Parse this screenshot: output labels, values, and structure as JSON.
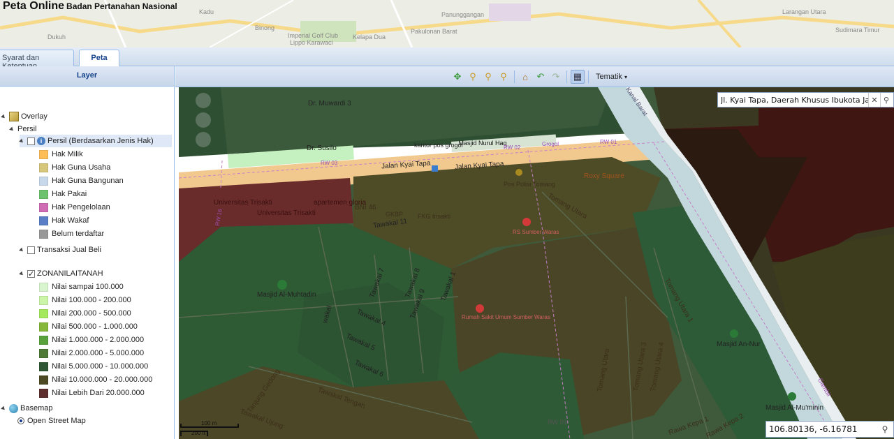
{
  "header": {
    "title": "Peta Online",
    "subtitle": "Badan Pertanahan Nasional",
    "places": [
      "Kadu",
      "Binong",
      "Imperial Golf Club",
      "Lippo Karawaci",
      "Kelapa Dua",
      "Pakulonan Barat",
      "Panunggangan",
      "Sudimara Timur",
      "Larangan Utara",
      "Dukuh"
    ]
  },
  "tabs": [
    {
      "label": "Syarat dan Ketentuan"
    },
    {
      "label": "Peta"
    }
  ],
  "layer_panel": {
    "title": "Layer",
    "overlay": "Overlay",
    "persil": "Persil",
    "persil_jenis_hak": "Persil (Berdasarkan Jenis Hak)",
    "legend_hak": [
      {
        "label": "Hak Milik",
        "color": "#fdbe58"
      },
      {
        "label": "Hak Guna Usaha",
        "color": "#d6c77b"
      },
      {
        "label": "Hak Guna Bangunan",
        "color": "#c7d8eb"
      },
      {
        "label": "Hak Pakai",
        "color": "#6dc36d"
      },
      {
        "label": "Hak Pengelolaan",
        "color": "#cf6cb5"
      },
      {
        "label": "Hak Wakaf",
        "color": "#5a7fc7"
      },
      {
        "label": "Belum terdaftar",
        "color": "#999999"
      }
    ],
    "transaksi": "Transaksi Jual Beli",
    "zona": "ZONANILAITANAH",
    "legend_zona": [
      {
        "label": "Nilai sampai 100.000",
        "color": "#d9f5cf"
      },
      {
        "label": "Nilai 100.000 - 200.000",
        "color": "#ccf5a8"
      },
      {
        "label": "Nilai 200.000 - 500.000",
        "color": "#a5ea5e"
      },
      {
        "label": "Nilai 500.000 - 1.000.000",
        "color": "#86b739"
      },
      {
        "label": "Nilai 1.000.000 - 2.000.000",
        "color": "#5aa33c"
      },
      {
        "label": "Nilai 2.000.000 - 5.000.000",
        "color": "#4e7a36"
      },
      {
        "label": "Nilai 5.000.000 - 10.000.000",
        "color": "#2e5633"
      },
      {
        "label": "Nilai 10.000.000 - 20.000.000",
        "color": "#4c4a25"
      },
      {
        "label": "Nilai Lebih Dari 20.000.000",
        "color": "#5e2e2e"
      }
    ],
    "basemap": "Basemap",
    "osm": "Open Street Map"
  },
  "toolbar": {
    "icons": [
      "pan-icon",
      "zoom-in-icon",
      "zoom-box-icon",
      "zoom-out-icon",
      "home-icon",
      "undo-icon",
      "redo-icon",
      "measure-icon"
    ],
    "tematik": "Tematik"
  },
  "map": {
    "search_value": "Jl. Kyai Tapa, Daerah Khusus Ibukota Jakarta",
    "coord_value": "106.80136, -6.16781",
    "scale_m": "100 m",
    "scale_ft": "200 ft",
    "labels": {
      "muwardi": "Dr. Muwardi 3",
      "susilo": "Dr. Susilo",
      "kantor_pos": "kantor pos grogol",
      "masjid_nurul": "Masjid Nurul Haq",
      "kyai_tapa1": "Jalan Kyai Tapa",
      "kyai_tapa2": "Jalan Kyai Tapa",
      "rw03": "RW 03",
      "rw02": "RW 02",
      "rw01": "RW 01",
      "grogol": "Grogol",
      "roxy": "Roxy Square",
      "pos_polisi": "Pos Polisi Tomang",
      "tomang_utara": "Tomang Utara",
      "rs_sumber": "RS Sumber Waras",
      "trisakti1": "Universitas Trisakti",
      "trisakti2": "Universitas Trisakti",
      "apartemen": "apartemen gloria",
      "bni": "BNI 46",
      "gkbp": "GKBP",
      "fkg": "FKG trisakti",
      "tawakal11": "Tawakal 11",
      "tawakal7": "Tawakal 7",
      "tawakal8": "Tawakal 8",
      "tawakal9": "Tawakal 9",
      "tawakal1": "Tawakal 1",
      "tawakal4": "Tawakal 4",
      "tawakal5": "Tawakal 5",
      "tawakal6": "Tawakal 6",
      "tawakal_tengah": "Tawakal Tengah",
      "tawakal_ujung": "Tawakal Ujung",
      "masjid_muhtadin": "Masjid Al-Muhtadin",
      "wakal": "wakal",
      "rs_umum": "Rumah Sakit Umum Sumber Waras",
      "tomang_utara2": "Tomang Utara",
      "tomang_utara3": "Tomang Utara 3",
      "tomang_utara4": "Tomang Utara 4",
      "tomang_utara1": "Tomang Utara 1",
      "masjid_annur": "Masjid An-Nur",
      "masjid_mumin": "Masjid Al-Mu'minin",
      "rawa_kepa1": "Rawa Kepa 1",
      "rawa_kepa2": "Rawa Kepa 2",
      "rw09": "RW 09",
      "gambir": "Gambir",
      "tanjung": "Tanjung Gedong",
      "banjir_kanal": "Banjir Kanal Barat",
      "rw16": "RW 16"
    }
  }
}
